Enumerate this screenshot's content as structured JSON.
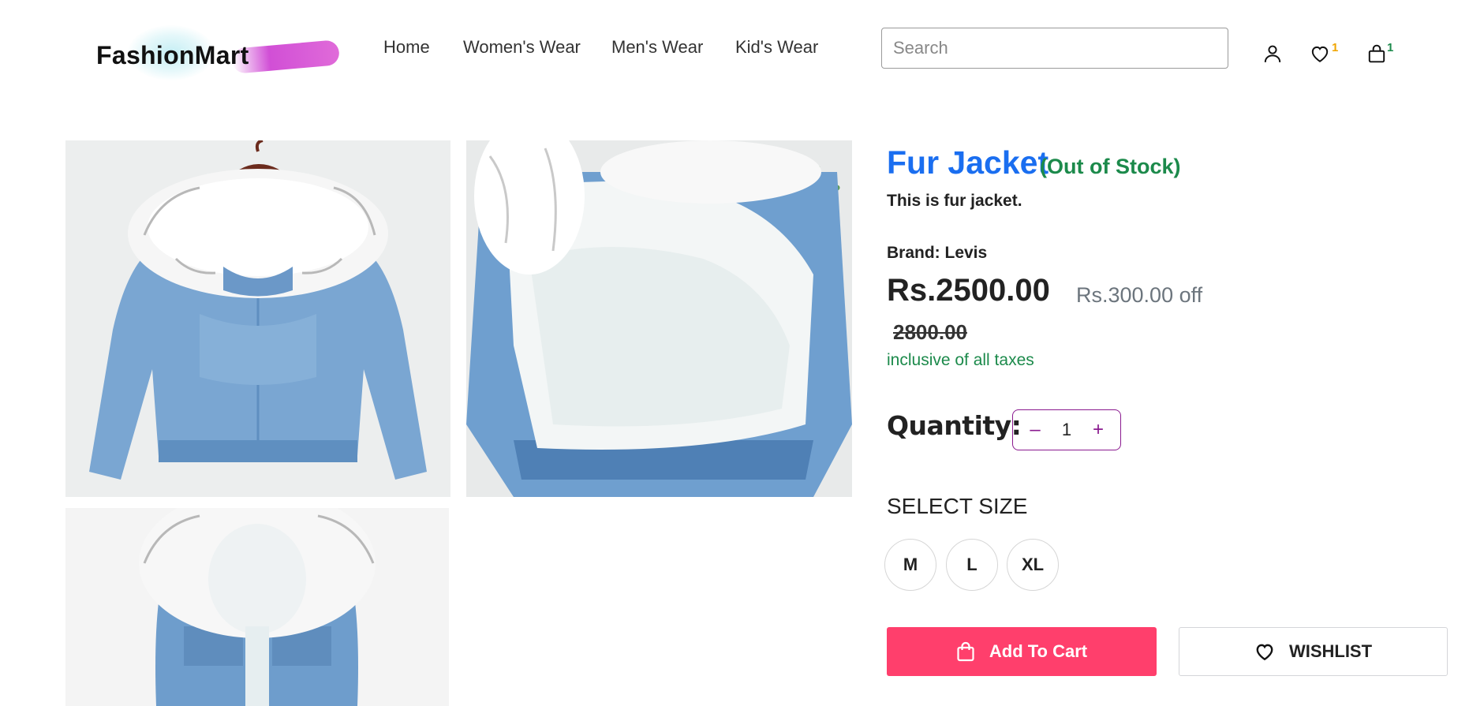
{
  "header": {
    "logo_text": "FashionMart",
    "nav": [
      {
        "label": "Home"
      },
      {
        "label": "Women's Wear"
      },
      {
        "label": "Men's Wear"
      },
      {
        "label": "Kid's Wear"
      }
    ],
    "search_placeholder": "Search",
    "wishlist_count": "1",
    "cart_count": "1"
  },
  "product": {
    "name": "Fur Jacket",
    "stock_status": "(Out of Stock)",
    "description": "This is fur jacket.",
    "brand": "Brand: Levis",
    "price": "Rs.2500.00",
    "discount": "Rs.300.00 off",
    "mrp": "2800.00",
    "tax_note": "inclusive of all taxes",
    "quantity_label": "Quantity:",
    "quantity": "1",
    "size_label": "SELECT SIZE",
    "sizes": [
      "M",
      "L",
      "XL"
    ],
    "add_to_cart_label": "Add To Cart",
    "wishlist_label": "WISHLIST"
  },
  "colors": {
    "title_blue": "#1a6ef0",
    "stock_green": "#1c8a4b",
    "cart_pink": "#ff3f6c",
    "stepper_purple": "#8a1a8f",
    "badge_yellow": "#f0a500",
    "badge_green": "#1c8a4b"
  },
  "icons": [
    "user-icon",
    "heart-icon",
    "shopping-bag-icon",
    "minus-icon",
    "plus-icon"
  ]
}
